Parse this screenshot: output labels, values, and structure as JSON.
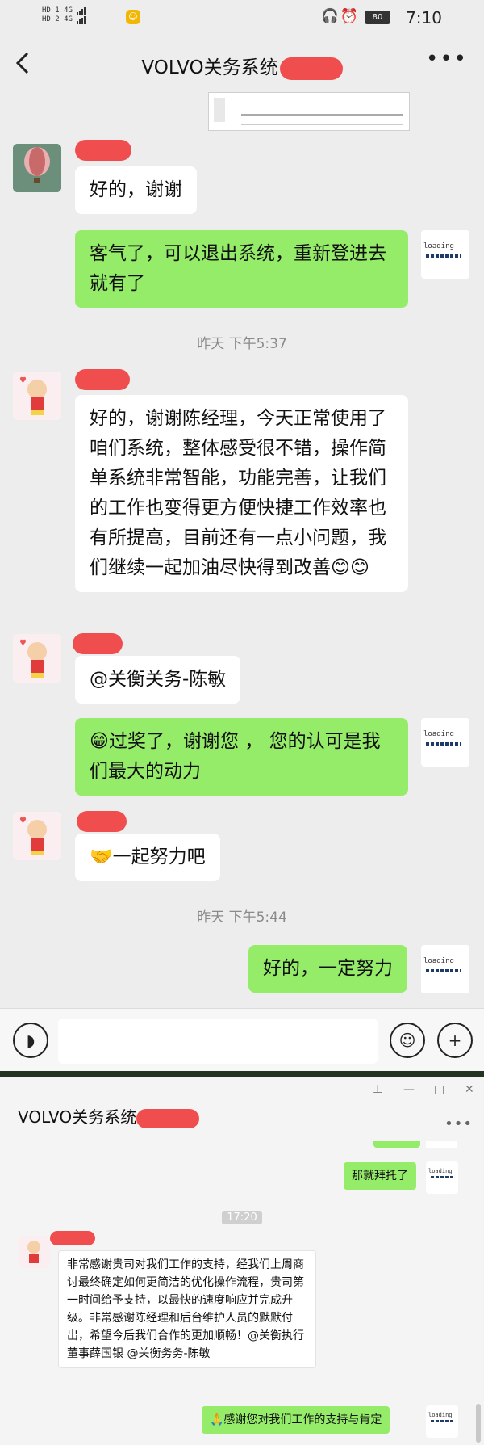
{
  "status_bar": {
    "network_1": "HD 1 4G",
    "network_2": "HD 2 4G",
    "battery": "80",
    "time": "7:10"
  },
  "header": {
    "title": "VOLVO关务系统",
    "back_icon": "chevron-left-icon",
    "more_icon": "more-dots-icon"
  },
  "messages": [
    {
      "side": "left",
      "text": "好的，谢谢"
    },
    {
      "side": "right",
      "text": "客气了，可以退出系统，重新登进去就有了"
    },
    {
      "type": "time",
      "text": "昨天 下午5:37"
    },
    {
      "side": "left",
      "text": "好的，谢谢陈经理，今天正常使用了咱们系统，整体感受很不错，操作简单系统非常智能，功能完善，让我们的工作也变得更方便快捷工作效率也有所提高，目前还有一点小问题，我们继续一起加油尽快得到改善😊😊"
    },
    {
      "side": "left",
      "text": "@关衡关务-陈敏"
    },
    {
      "side": "right",
      "text": "😁过奖了，谢谢您 ， 您的认可是我们最大的动力"
    },
    {
      "side": "left",
      "text": "🤝一起努力吧"
    },
    {
      "type": "time",
      "text": "昨天 下午5:44"
    },
    {
      "side": "right",
      "text": "好的，一定努力"
    }
  ],
  "avatar_label": "loading",
  "input_bar": {
    "voice_icon": "voice-icon",
    "emoji_icon": "emoji-icon",
    "plus_icon": "plus-icon",
    "input_value": ""
  },
  "desktop": {
    "title": "VOLVO关务系统",
    "pin_icon": "pin-icon",
    "minimize_icon": "minimize-icon",
    "maximize_icon": "maximize-icon",
    "close_icon": "close-icon",
    "messages": [
      {
        "side": "right",
        "text": "那就拜托了"
      },
      {
        "type": "time",
        "text": "17:20"
      },
      {
        "side": "left",
        "text": "非常感谢贵司对我们工作的支持，经我们上周商讨最终确定如何更简洁的优化操作流程，贵司第一时间给予支持，以最快的速度响应并完成升级。非常感谢陈经理和后台维护人员的默默付出，希望今后我们合作的更加顺畅！@关衡执行董事薛国银 @关衡务务-陈敏"
      },
      {
        "side": "right",
        "text": "🙏感谢您对我们工作的支持与肯定"
      }
    ]
  },
  "colors": {
    "accent_green": "#95ec69",
    "redaction": "#f04e4e",
    "background": "#ededed"
  }
}
